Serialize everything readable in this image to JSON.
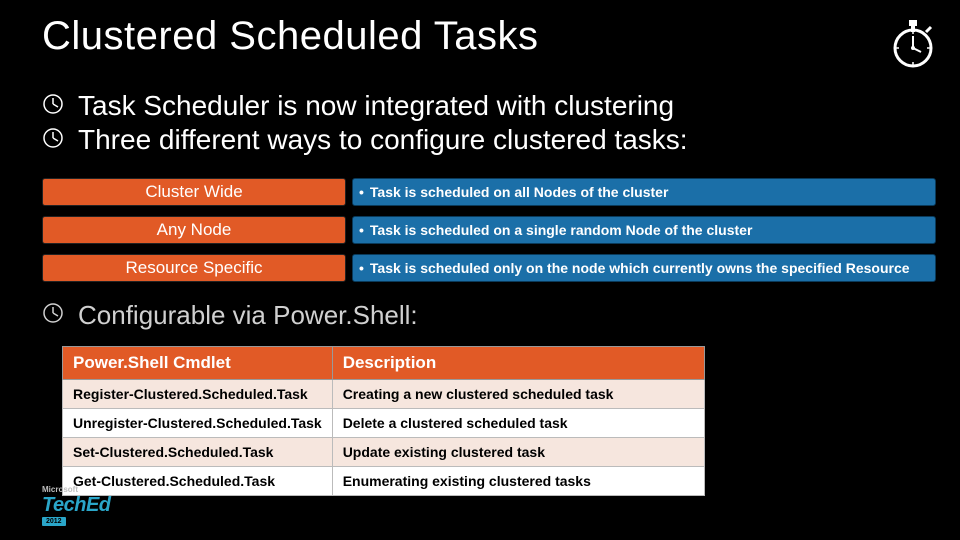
{
  "title": "Clustered Scheduled Tasks",
  "icons": {
    "top_right": "stopwatch-icon",
    "bullet": "clock-icon"
  },
  "bullets": {
    "b1": "Task Scheduler is now integrated with clustering",
    "b2": "Three different ways to configure clustered tasks:"
  },
  "modes": [
    {
      "label": "Cluster Wide",
      "desc": "Task is scheduled on all Nodes of the cluster"
    },
    {
      "label": "Any Node",
      "desc": "Task is scheduled on a single random Node of the cluster"
    },
    {
      "label": "Resource Specific",
      "desc": "Task is scheduled only on the node which currently owns the specified Resource"
    }
  ],
  "section2": "Configurable via Power.Shell:",
  "table": {
    "headers": {
      "cmd": "Power.Shell Cmdlet",
      "desc": "Description"
    },
    "rows": [
      {
        "cmd": "Register-Clustered.Scheduled.Task",
        "desc": "Creating a new clustered scheduled task"
      },
      {
        "cmd": "Unregister-Clustered.Scheduled.Task",
        "desc": "Delete a clustered scheduled task"
      },
      {
        "cmd": "Set-Clustered.Scheduled.Task",
        "desc": "Update existing clustered task"
      },
      {
        "cmd": "Get-Clustered.Scheduled.Task",
        "desc": "Enumerating existing clustered tasks"
      }
    ]
  },
  "logo": {
    "vendor": "Microsoft",
    "brand": "TechEd",
    "year": "2012"
  },
  "colors": {
    "accent_orange": "#e15a26",
    "accent_blue": "#1b6fa8",
    "brand_teal": "#2aa6c9"
  }
}
